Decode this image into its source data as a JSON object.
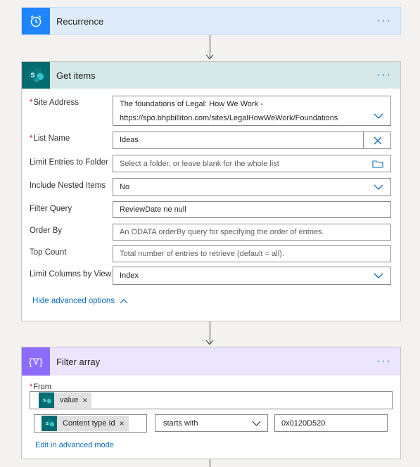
{
  "recurrence": {
    "title": "Recurrence",
    "icon": "alarm-clock-icon",
    "color": "#1f85ff",
    "header_bg": "#deecf9",
    "more": "···"
  },
  "get_items": {
    "title": "Get items",
    "icon": "sharepoint-icon",
    "color": "#036c70",
    "header_bg": "#d7e8e8",
    "more": "···",
    "site_address": {
      "label": "Site Address",
      "required": "*",
      "value_line1": "The foundations of Legal: How We Work -",
      "value_line2": "https://spo.bhpbilliton.com/sites/LegalHowWeWork/Foundations"
    },
    "list_name": {
      "label": "List Name",
      "required": "*",
      "value": "Ideas"
    },
    "limit_folder": {
      "label": "Limit Entries to Folder",
      "placeholder": "Select a folder, or leave blank for the whole list"
    },
    "nested_items": {
      "label": "Include Nested Items",
      "value": "No"
    },
    "filter_query": {
      "label": "Filter Query",
      "value": "ReviewDate ne null"
    },
    "order_by": {
      "label": "Order By",
      "placeholder": "An ODATA orderBy query for specifying the order of entries."
    },
    "top_count": {
      "label": "Top Count",
      "placeholder": "Total number of entries to retrieve (default = all)."
    },
    "limit_columns": {
      "label": "Limit Columns by View",
      "value": "Index"
    },
    "hide_advanced": "Hide advanced options"
  },
  "filter_array": {
    "title": "Filter array",
    "icon": "filter-array-icon",
    "color": "#8c6cff",
    "header_bg": "#ebe5ff",
    "more": "···",
    "from": {
      "label": "From",
      "required": "*",
      "token": "value"
    },
    "condition": {
      "left_token": "Content type Id",
      "operator": "starts with",
      "right_value": "0x0120D520"
    },
    "edit_advanced": "Edit in advanced mode"
  }
}
